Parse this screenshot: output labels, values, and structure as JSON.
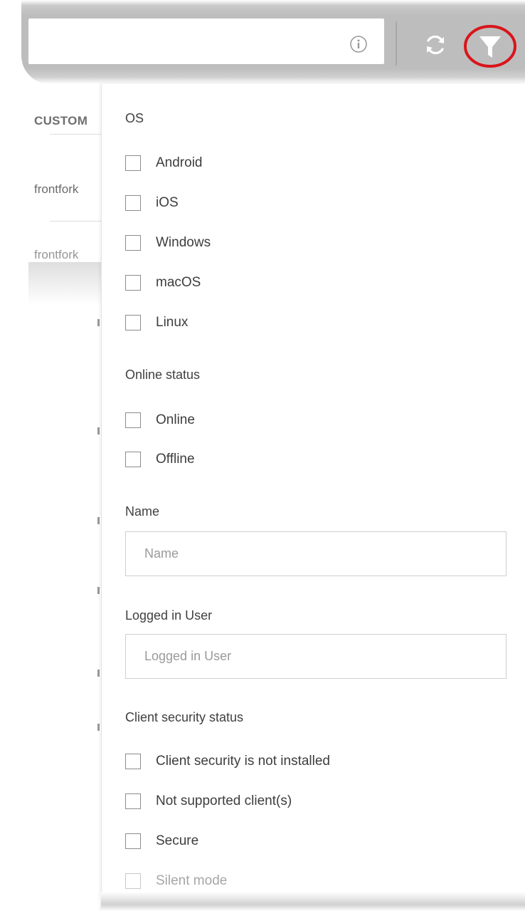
{
  "toolbar": {
    "search_value": "",
    "info_icon": "info-icon",
    "refresh_icon": "refresh-icon",
    "filter_icon": "filter-icon",
    "highlight_color": "#d9151b"
  },
  "background_table": {
    "column_header": "CUSTOM",
    "rows": [
      "frontfork",
      "frontfork"
    ]
  },
  "filter_panel": {
    "os": {
      "title": "OS",
      "options": [
        "Android",
        "iOS",
        "Windows",
        "macOS",
        "Linux"
      ]
    },
    "online_status": {
      "title": "Online status",
      "options": [
        "Online",
        "Offline"
      ]
    },
    "name": {
      "title": "Name",
      "placeholder": "Name",
      "value": ""
    },
    "logged_in_user": {
      "title": "Logged in User",
      "placeholder": "Logged in User",
      "value": ""
    },
    "client_security_status": {
      "title": "Client security status",
      "options": [
        "Client security is not installed",
        "Not supported client(s)",
        "Secure",
        "Silent mode"
      ]
    }
  }
}
